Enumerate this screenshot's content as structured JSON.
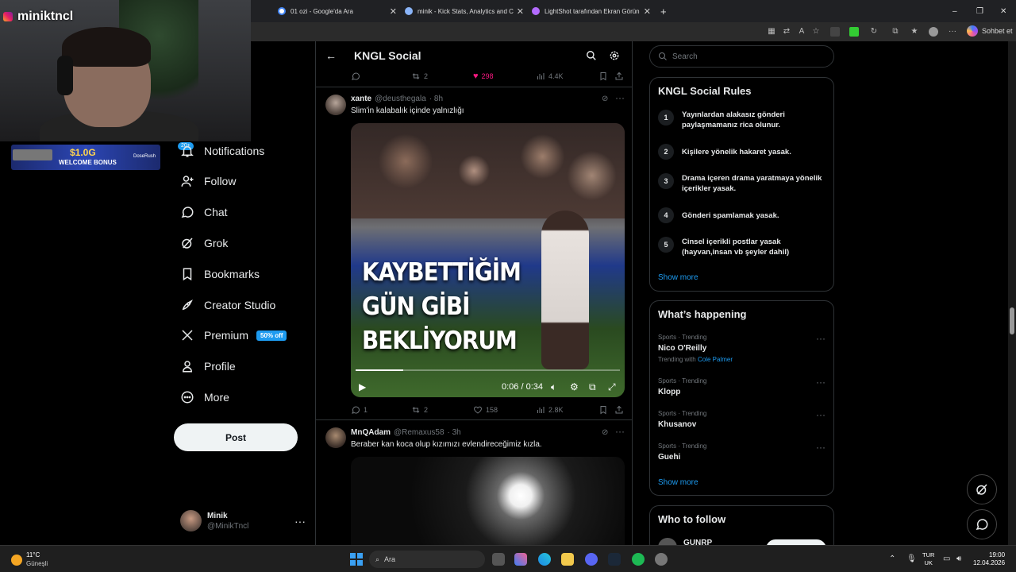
{
  "browser": {
    "tabs": [
      {
        "label": "01 ozi - Google'da Ara",
        "color": "#4285f4"
      },
      {
        "label": "minik - Kick Stats, Analytics and C",
        "color": "#8ab4f8"
      },
      {
        "label": "LightShot tarafından Ekran Görün",
        "color": "#b36bff"
      }
    ],
    "new_tab": "+",
    "window_controls": [
      "–",
      "❐",
      "✕"
    ],
    "copilot_label": "Sohbet et"
  },
  "stream_overlay": {
    "streamer": "miniktncl",
    "banner_amount": "$1.0G",
    "banner_text": "WELCOME BONUS",
    "banner_brand": "DoseRush",
    "notif_badge": "20+"
  },
  "sidebar": {
    "items": [
      {
        "label": "Notifications",
        "icon": "bell-icon"
      },
      {
        "label": "Follow",
        "icon": "follow-icon"
      },
      {
        "label": "Chat",
        "icon": "chat-icon"
      },
      {
        "label": "Grok",
        "icon": "grok-icon"
      },
      {
        "label": "Bookmarks",
        "icon": "bookmark-icon"
      },
      {
        "label": "Creator Studio",
        "icon": "rocket-icon"
      },
      {
        "label": "Premium",
        "icon": "x-logo-icon"
      },
      {
        "label": "Profile",
        "icon": "person-icon"
      },
      {
        "label": "More",
        "icon": "more-circle-icon"
      }
    ],
    "premium_badge": "50% off",
    "post_button": "Post",
    "profile": {
      "name": "Minik",
      "handle": "@MinikTncl",
      "more": "···"
    }
  },
  "header": {
    "title": "KNGL Social"
  },
  "feed": {
    "top_actions": {
      "retweets": "2",
      "likes": "298",
      "views": "4.4K"
    },
    "post1": {
      "author": "xante",
      "handle": "@deusthegala",
      "time": "· 8h",
      "text": "Slim'in kalabalık içinde yalnızlığı",
      "video_text": [
        "KAYBETTİĞİM",
        "GÜN GİBİ",
        "BEKLİYORUM"
      ],
      "video_time": "0:06 / 0:34",
      "video_progress": 0.18,
      "actions": {
        "replies": "1",
        "retweets": "2",
        "likes": "158",
        "views": "2.8K"
      }
    },
    "post2": {
      "author": "MnQAdam",
      "handle": "@Remaxus58",
      "time": "· 3h",
      "text": "Beraber kan koca olup kızımızı evlendireceğimiz kızla."
    }
  },
  "right": {
    "search_placeholder": "Search",
    "rules": {
      "title": "KNGL Social Rules",
      "items": [
        {
          "n": "1",
          "text": "Yayınlardan alakasız gönderi paylaşmamanız rica olunur."
        },
        {
          "n": "2",
          "text": "Kişilere yönelik hakaret yasak."
        },
        {
          "n": "3",
          "text": "Drama içeren drama yaratmaya yönelik içerikler yasak."
        },
        {
          "n": "4",
          "text": "Gönderi spamlamak yasak."
        },
        {
          "n": "5",
          "text": "Cinsel içerikli postlar yasak (hayvan,insan vb şeyler dahil)"
        }
      ],
      "show_more": "Show more"
    },
    "happening": {
      "title": "What’s happening",
      "items": [
        {
          "meta": "Sports · Trending",
          "name": "Nico O'Reilly",
          "sub_prefix": "Trending with",
          "sub_link": "Cole Palmer"
        },
        {
          "meta": "Sports · Trending",
          "name": "Klopp"
        },
        {
          "meta": "Sports · Trending",
          "name": "Khusanov"
        },
        {
          "meta": "Sports · Trending",
          "name": "Guehi"
        }
      ],
      "show_more": "Show more"
    },
    "who_to_follow": {
      "title": "Who to follow",
      "first": "GUNRP"
    }
  },
  "taskbar": {
    "weather_temp": "11°C",
    "weather_desc": "Güneşli",
    "search": "Ara",
    "lang_top": "TUR",
    "lang_bottom": "UK",
    "time": "19:00",
    "date": "12.04.2026"
  }
}
